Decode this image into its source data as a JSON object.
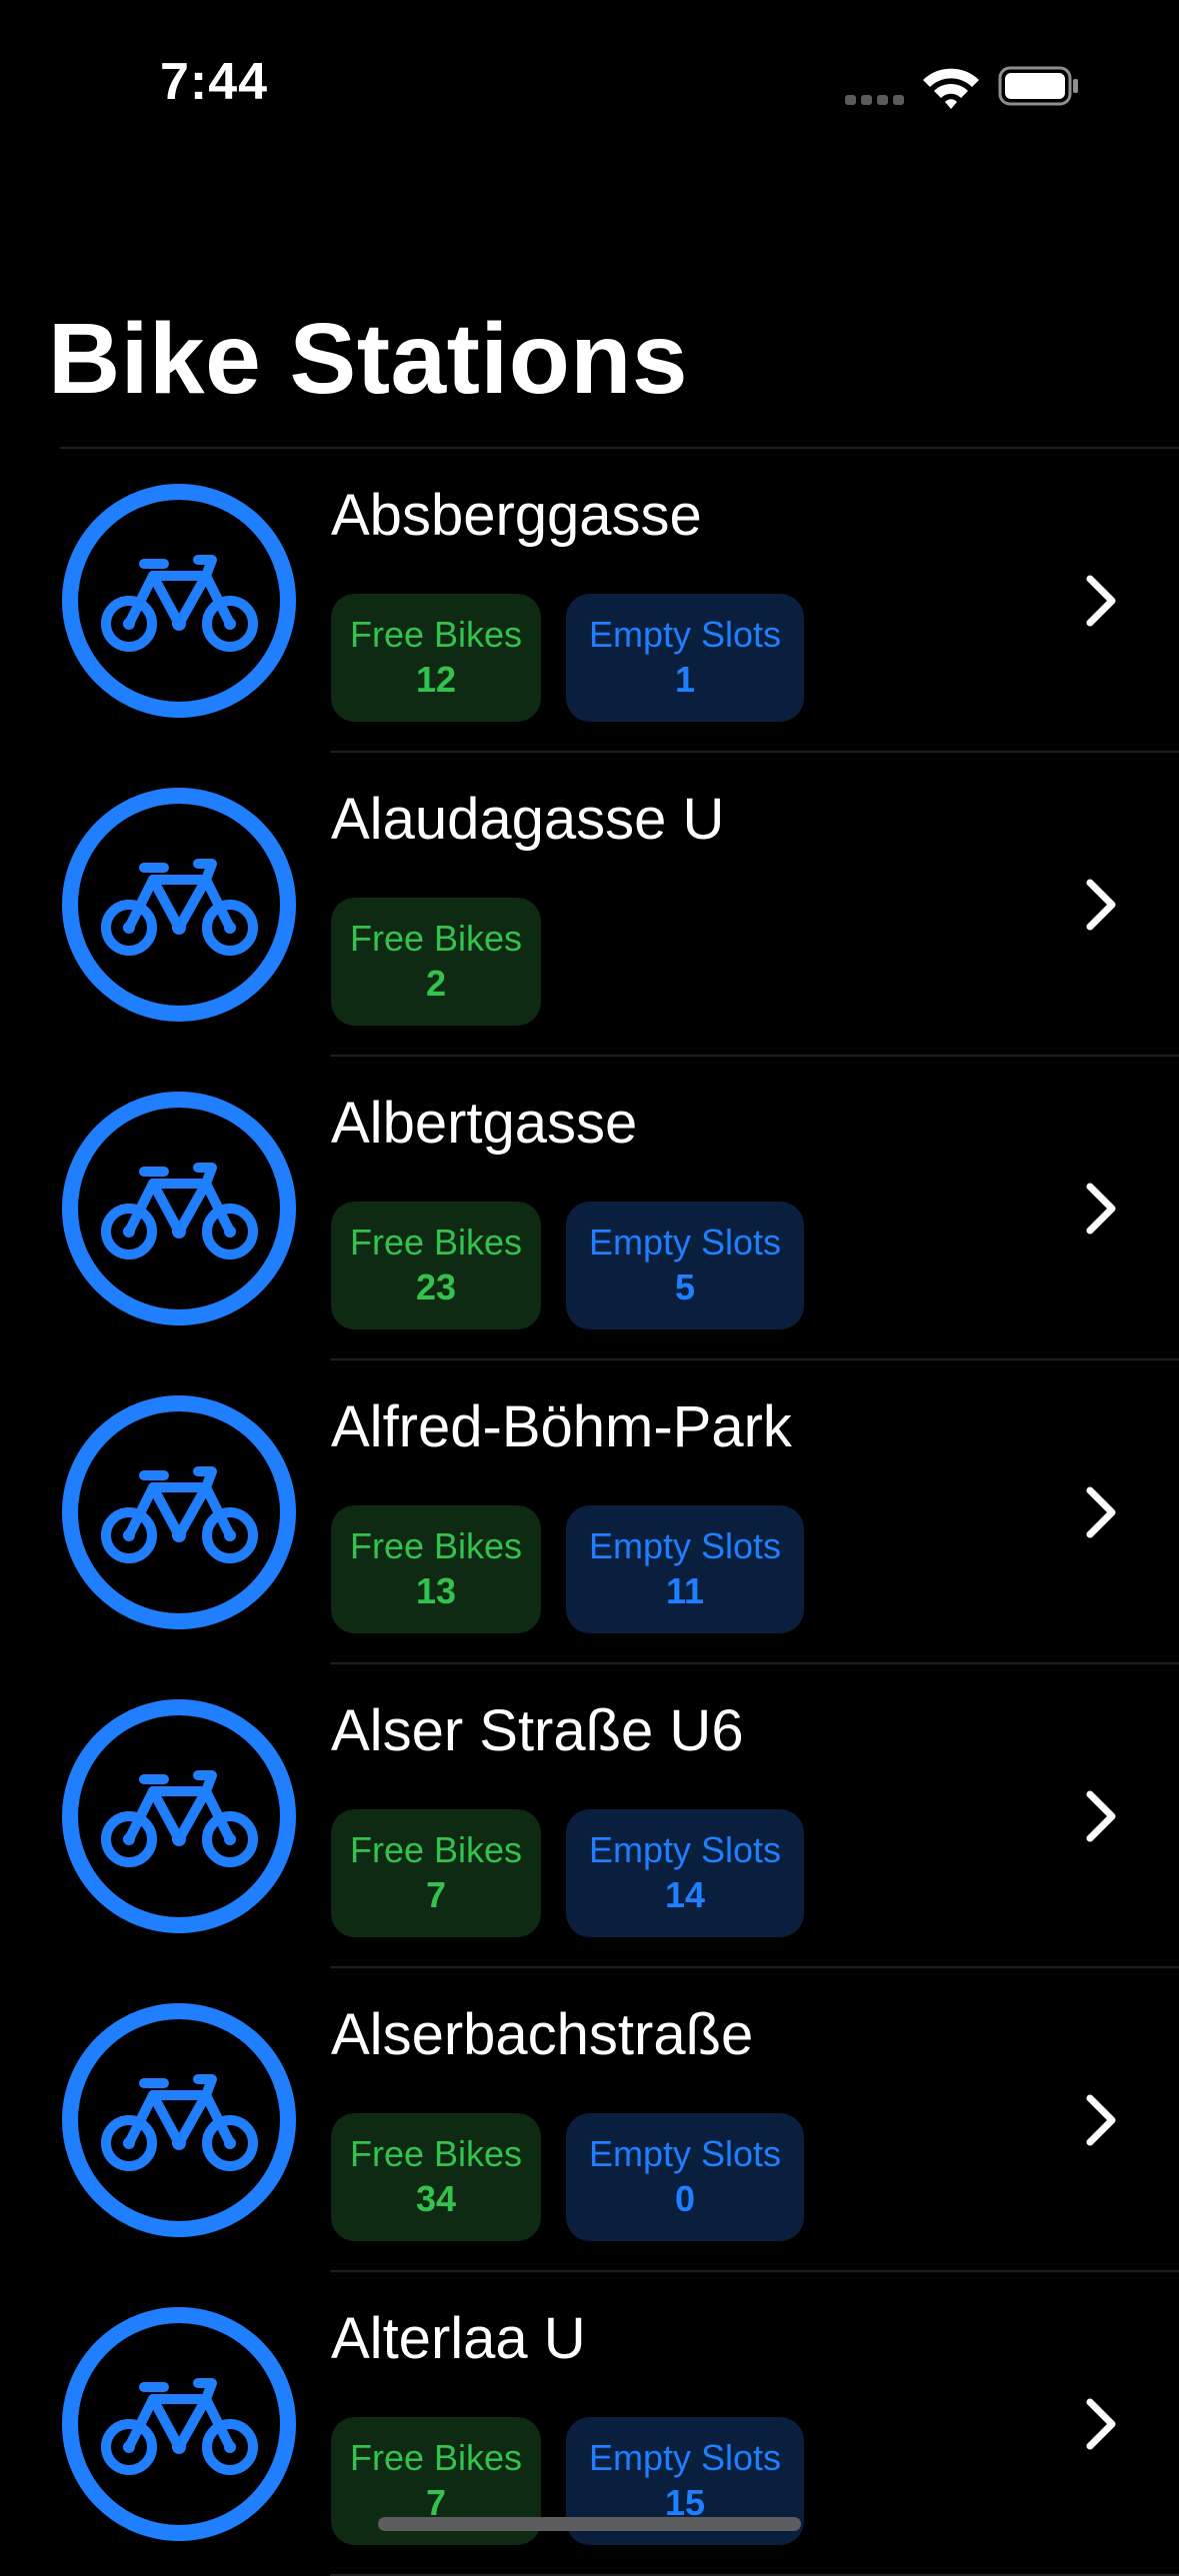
{
  "status_bar": {
    "time": "7:44"
  },
  "header": {
    "title": "Bike Stations"
  },
  "colors": {
    "accent_blue": "#1f7fff",
    "free_green": "#33c24d",
    "background": "#000000"
  },
  "stations": [
    {
      "name": "Absberggasse",
      "free_bikes_label": "Free Bikes",
      "free_bikes": "12",
      "empty_slots_label": "Empty Slots",
      "empty_slots": "1"
    },
    {
      "name": "Alaudagasse U",
      "free_bikes_label": "Free Bikes",
      "free_bikes": "2",
      "empty_slots_label": "",
      "empty_slots": ""
    },
    {
      "name": "Albertgasse",
      "free_bikes_label": "Free Bikes",
      "free_bikes": "23",
      "empty_slots_label": "Empty Slots",
      "empty_slots": "5"
    },
    {
      "name": "Alfred-Böhm-Park",
      "free_bikes_label": "Free Bikes",
      "free_bikes": "13",
      "empty_slots_label": "Empty Slots",
      "empty_slots": "11"
    },
    {
      "name": "Alser Straße U6",
      "free_bikes_label": "Free Bikes",
      "free_bikes": "7",
      "empty_slots_label": "Empty Slots",
      "empty_slots": "14"
    },
    {
      "name": "Alserbachstraße",
      "free_bikes_label": "Free Bikes",
      "free_bikes": "34",
      "empty_slots_label": "Empty Slots",
      "empty_slots": "0"
    },
    {
      "name": "Alterlaa U",
      "free_bikes_label": "Free Bikes",
      "free_bikes": "7",
      "empty_slots_label": "Empty Slots",
      "empty_slots": "15"
    }
  ]
}
